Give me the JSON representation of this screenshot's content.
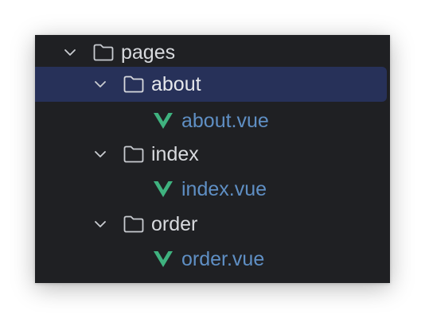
{
  "tree": {
    "root": {
      "label": "pages",
      "expanded": true
    },
    "folders": [
      {
        "label": "about",
        "expanded": true,
        "selected": true,
        "file": {
          "label": "about.vue"
        }
      },
      {
        "label": "index",
        "expanded": true,
        "selected": false,
        "file": {
          "label": "index.vue"
        }
      },
      {
        "label": "order",
        "expanded": true,
        "selected": false,
        "file": {
          "label": "order.vue"
        }
      }
    ]
  },
  "icons": {
    "chevron": "chevron-down-icon",
    "folder": "folder-icon",
    "vue": "vue-file-icon"
  },
  "colors": {
    "background": "#1f2023",
    "selection": "#273159",
    "folder_text": "#d8dade",
    "file_text": "#5f8fc4",
    "vue_green": "#3fb27f",
    "icon_stroke": "#c9ccd1"
  }
}
